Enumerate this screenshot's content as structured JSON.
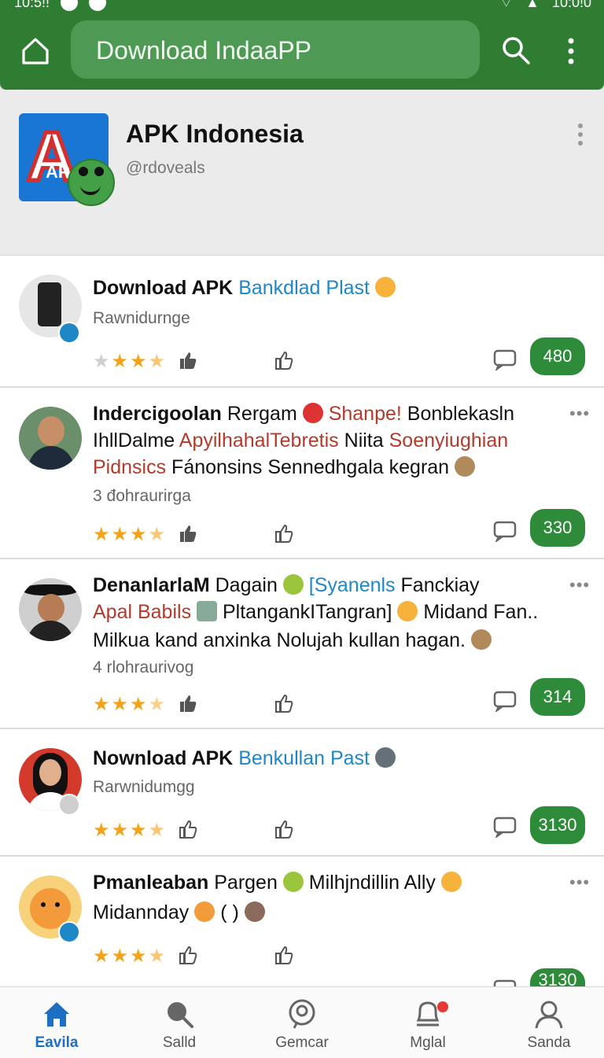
{
  "statusbar": {
    "time_left": "10:5!!",
    "time_right": "10:0!0"
  },
  "appbar": {
    "search_text": "Download IndaaPP"
  },
  "header": {
    "title": "APK Indonesia",
    "handle": "@rdoveals",
    "logo_text": "AP"
  },
  "posts": [
    {
      "title_bold": "Download APK",
      "title_link": "Bankdlad Plast",
      "subtitle": "Rawnidurnge",
      "rating": 3,
      "count": "480"
    },
    {
      "line1_bold": "Indercigoolan",
      "line1_a": "Rergam",
      "line1_red": "Shanpe!",
      "line1_b": "Bonblekasln",
      "line2_a": "IhllDalme",
      "line2_red_a": "ApyilhahalTebretis",
      "line2_b": "Niita",
      "line2_red_b": "Soenyiughian",
      "line3_red": "Pidnsics",
      "line3_a": "Fánonsins Sennedhgala kegran",
      "subtitle": "3  đohraurirga",
      "rating": 4,
      "count": "330"
    },
    {
      "line1_bold": "DenanlarlaM",
      "line1_a": "Dagain",
      "line1_blue": "[Syanenls",
      "line1_b": "Fanckiay",
      "line2_red": "Apal Babils",
      "line2_a": "PltangankITangran]",
      "line2_b": "Midand Fan..",
      "line3": "Milkua kand anxinka Nolujah kullan hagan.",
      "subtitle": "4  rlohraurivog",
      "rating": 3,
      "count": "314"
    },
    {
      "title_bold": "Nownload APK",
      "title_link": "Benkullan Past",
      "subtitle": "Rarwnidumgg",
      "rating": 3,
      "count": "3130"
    },
    {
      "line1_bold": "Pmanleaban",
      "line1_a": "Pargen",
      "line1_b": "Milhjndillin Ally",
      "line2_a": "Midannday",
      "line2_b": "(        )",
      "rating": 4,
      "count": "3130"
    }
  ],
  "bottom_nav": [
    {
      "label": "Eavila",
      "active": true
    },
    {
      "label": "Salld",
      "active": false
    },
    {
      "label": "Gemcar",
      "active": false
    },
    {
      "label": "Mglal",
      "active": false
    },
    {
      "label": "Sanda",
      "active": false
    }
  ],
  "colors": {
    "brand_green": "#2e7d32",
    "pill_green": "#2e8b3a",
    "link_blue": "#1e88c7",
    "accent_red": "#b23b2b",
    "star": "#f2a31a"
  }
}
